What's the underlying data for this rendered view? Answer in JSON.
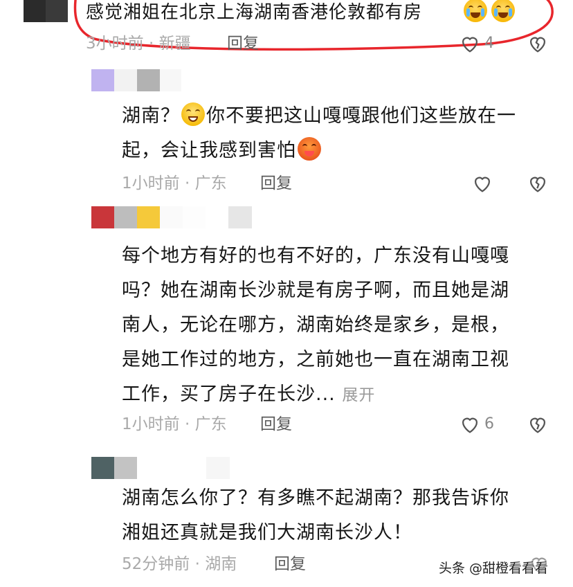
{
  "comments": [
    {
      "text": "感觉湘姐在北京上海湖南香港伦敦都有房",
      "meta": "3小时前 · 新疆",
      "reply_label": "回复",
      "likes": "4"
    },
    {
      "line1_a": "湖南？",
      "line1_b": "你不要把这山嘎嘎跟他们这些放在一",
      "line2": "起，会让我感到害怕",
      "meta": "1小时前 · 广东",
      "reply_label": "回复"
    },
    {
      "lines": [
        "每个地方有好的也有不好的，广东没有山嘎嘎",
        "吗？她在湖南长沙就是有房子啊，而且她是湖",
        "南人，无论在哪方，湖南始终是家乡，是根，",
        "是她工作过的地方，之前她也一直在湖南卫视",
        "工作，买了房子在长沙..."
      ],
      "expand_label": "展开",
      "meta": "1小时前 · 广东",
      "reply_label": "回复",
      "likes": "6"
    },
    {
      "lines": [
        "湖南怎么你了？有多瞧不起湖南？那我告诉你",
        "湘姐还真就是我们大湖南长沙人！"
      ],
      "meta": "52分钟前 · 湖南",
      "reply_label": "回复"
    }
  ],
  "watermark": "头条 @甜橙看看看",
  "icons": {
    "like": "heart-outline-icon",
    "dislike": "broken-heart-icon"
  },
  "colors": {
    "annotation": "#e8262c"
  }
}
